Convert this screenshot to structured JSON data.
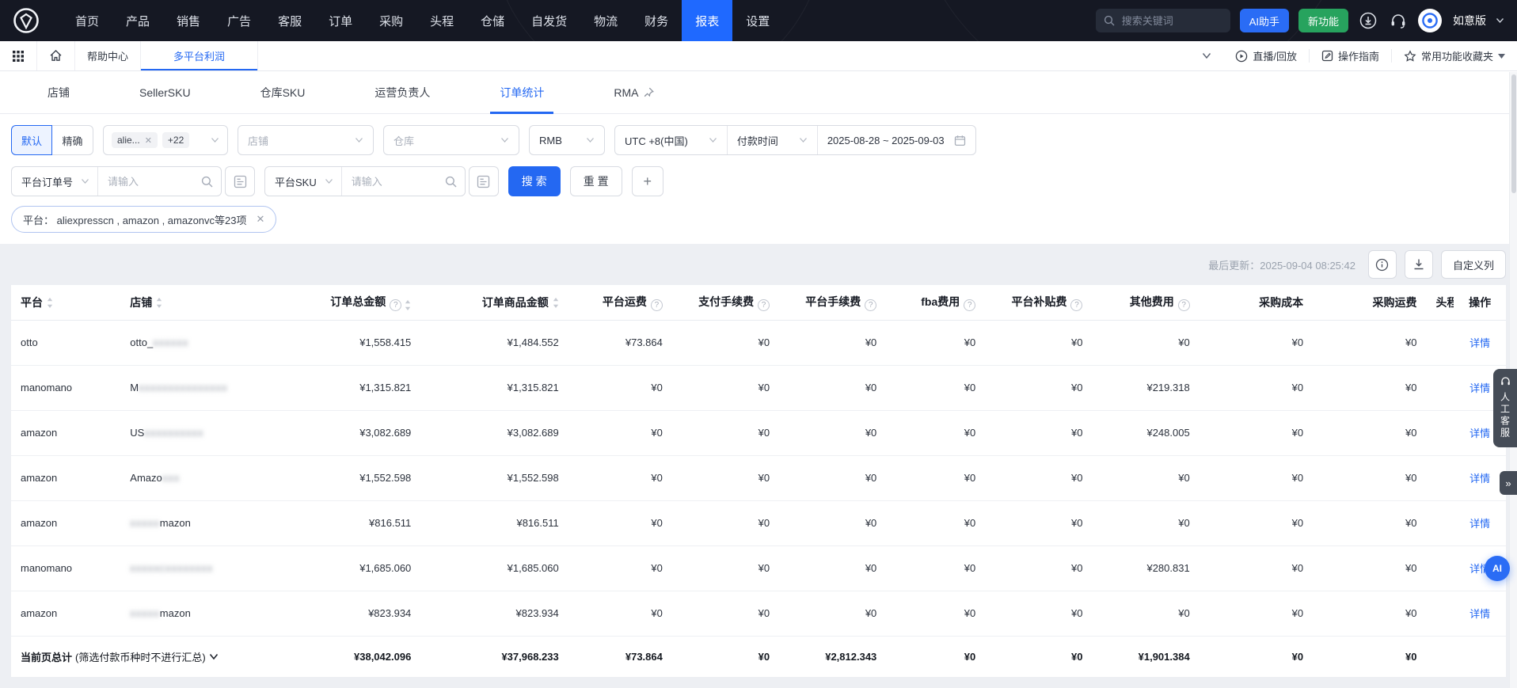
{
  "navbar": {
    "menu": [
      {
        "label": "首页"
      },
      {
        "label": "产品"
      },
      {
        "label": "销售"
      },
      {
        "label": "广告"
      },
      {
        "label": "客服"
      },
      {
        "label": "订单"
      },
      {
        "label": "采购"
      },
      {
        "label": "头程"
      },
      {
        "label": "仓储"
      },
      {
        "label": "自发货"
      },
      {
        "label": "物流"
      },
      {
        "label": "财务"
      },
      {
        "label": "报表"
      },
      {
        "label": "设置"
      }
    ],
    "active_index": 12,
    "search_placeholder": "搜索关键词",
    "ai_button": "AI助手",
    "new_button": "新功能",
    "user_name": "如意版"
  },
  "toolbar": {
    "help_tab": "帮助中心",
    "active_tab": "多平台利润",
    "live": "直播/回放",
    "guide": "操作指南",
    "favorites": "常用功能收藏夹"
  },
  "tabs": {
    "items": [
      {
        "label": "店铺"
      },
      {
        "label": "SellerSKU"
      },
      {
        "label": "仓库SKU"
      },
      {
        "label": "运营负责人"
      },
      {
        "label": "订单统计"
      },
      {
        "label": "RMA"
      }
    ],
    "active_index": 4
  },
  "filters": {
    "mode_default": "默认",
    "mode_exact": "精确",
    "platform_tag": "alie...",
    "platform_more": "+22",
    "store_placeholder": "店铺",
    "warehouse_placeholder": "仓库",
    "currency": "RMB",
    "timezone": "UTC +8(中国)",
    "time_type": "付款时间",
    "date_range": "2025-08-28 ~ 2025-09-03",
    "order_no_field": "平台订单号",
    "sku_field": "平台SKU",
    "input_placeholder": "请输入",
    "search_button": "搜 索",
    "reset_button": "重 置",
    "add_button": "+",
    "platform_filter_tag": "平台： aliexpresscn , amazon , amazonvc等23项"
  },
  "meta": {
    "last_update_label": "最后更新：",
    "last_update_value": "2025-09-04 08:25:42",
    "customize_button": "自定义列"
  },
  "table": {
    "action_label": "详情",
    "columns": [
      {
        "label": "平台"
      },
      {
        "label": "店铺"
      },
      {
        "label": "订单总金额"
      },
      {
        "label": "订单商品金额"
      },
      {
        "label": "平台运费"
      },
      {
        "label": "支付手续费"
      },
      {
        "label": "平台手续费"
      },
      {
        "label": "fba费用"
      },
      {
        "label": "平台补贴费"
      },
      {
        "label": "其他费用"
      },
      {
        "label": "采购成本"
      },
      {
        "label": "采购运费"
      },
      {
        "label": "头程"
      },
      {
        "label": "操作"
      }
    ],
    "rows": [
      {
        "platform": "otto",
        "store_prefix": "otto_",
        "store_blur": "xxxxxx",
        "store_suffix": "",
        "values": [
          "¥1,558.415",
          "¥1,484.552",
          "¥73.864",
          "¥0",
          "¥0",
          "¥0",
          "¥0",
          "¥0",
          "¥0",
          "¥0"
        ]
      },
      {
        "platform": "manomano",
        "store_prefix": "M",
        "store_blur": "xxxxxxxxxxxxxxx",
        "store_suffix": "",
        "values": [
          "¥1,315.821",
          "¥1,315.821",
          "¥0",
          "¥0",
          "¥0",
          "¥0",
          "¥0",
          "¥219.318",
          "¥0",
          "¥0"
        ]
      },
      {
        "platform": "amazon",
        "store_prefix": "US",
        "store_blur": "xxxxxxxxxx",
        "store_suffix": "",
        "values": [
          "¥3,082.689",
          "¥3,082.689",
          "¥0",
          "¥0",
          "¥0",
          "¥0",
          "¥0",
          "¥248.005",
          "¥0",
          "¥0"
        ]
      },
      {
        "platform": "amazon",
        "store_prefix": "Amazo",
        "store_blur": "xxx",
        "store_suffix": "",
        "values": [
          "¥1,552.598",
          "¥1,552.598",
          "¥0",
          "¥0",
          "¥0",
          "¥0",
          "¥0",
          "¥0",
          "¥0",
          "¥0"
        ]
      },
      {
        "platform": "amazon",
        "store_prefix": "",
        "store_blur": "xxxxx",
        "store_suffix": "mazon",
        "values": [
          "¥816.511",
          "¥816.511",
          "¥0",
          "¥0",
          "¥0",
          "¥0",
          "¥0",
          "¥0",
          "¥0",
          "¥0"
        ]
      },
      {
        "platform": "manomano",
        "store_prefix": "",
        "store_blur": "xxxxxcxxxxxxxx",
        "store_suffix": "",
        "values": [
          "¥1,685.060",
          "¥1,685.060",
          "¥0",
          "¥0",
          "¥0",
          "¥0",
          "¥0",
          "¥280.831",
          "¥0",
          "¥0"
        ]
      },
      {
        "platform": "amazon",
        "store_prefix": "",
        "store_blur": "xxxxx",
        "store_suffix": "mazon",
        "values": [
          "¥823.934",
          "¥823.934",
          "¥0",
          "¥0",
          "¥0",
          "¥0",
          "¥0",
          "¥0",
          "¥0",
          "¥0"
        ]
      }
    ],
    "summary": {
      "label": "当前页总计",
      "note": "(筛选付款币种时不进行汇总)",
      "values": [
        "¥38,042.096",
        "¥37,968.233",
        "¥73.864",
        "¥0",
        "¥2,812.343",
        "¥0",
        "¥0",
        "¥1,901.384",
        "¥0",
        "¥0"
      ]
    }
  },
  "floating": {
    "service": "人工客服",
    "collapse": "»",
    "ai": "AI"
  }
}
